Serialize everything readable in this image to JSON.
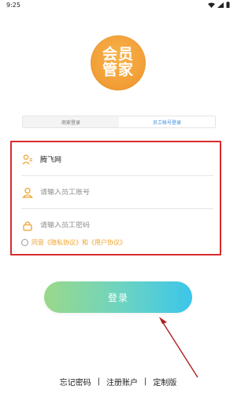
{
  "status": {
    "time": "9:25"
  },
  "logo": {
    "line1": "会员",
    "line2": "管家",
    "color": "#f3a23a"
  },
  "tabs": [
    {
      "label": "商家登录",
      "active": false
    },
    {
      "label": "员工帐号登录",
      "active": true
    }
  ],
  "form": {
    "merchant": {
      "value": "腾飞网",
      "icon": "merchant-user-icon"
    },
    "account": {
      "placeholder": "请输入员工账号",
      "icon": "user-icon"
    },
    "password": {
      "placeholder": "请输入员工密码",
      "icon": "lock-icon"
    }
  },
  "agreement": {
    "text": "同意《隐私协议》和《用户协议》",
    "color": "#f0a22b"
  },
  "login": {
    "label": "登录",
    "gradient": [
      "#9ad88a",
      "#6fd4bf",
      "#3bc6ea"
    ]
  },
  "footer": {
    "forgot": "忘记密码",
    "register": "注册账户",
    "custom": "定制版",
    "separator": "|"
  },
  "annotation": {
    "box_color": "#d72b2b",
    "arrow_color": "#b01f1f"
  }
}
